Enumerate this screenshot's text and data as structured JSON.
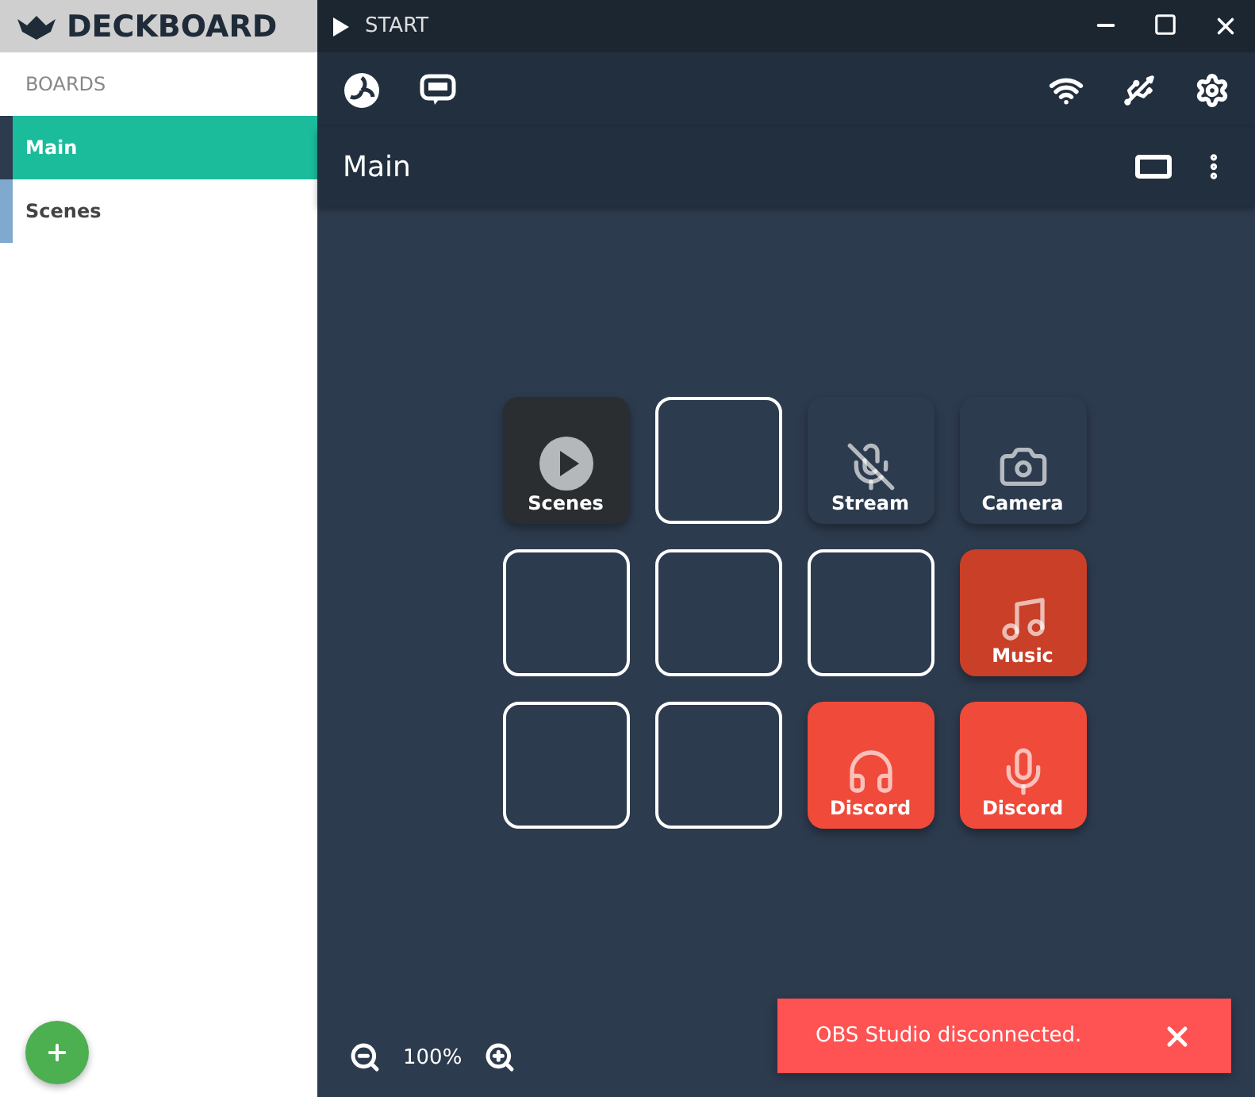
{
  "app": {
    "name": "DECKBOARD"
  },
  "sidebar": {
    "heading": "BOARDS",
    "items": [
      {
        "label": "Main",
        "selected": true
      },
      {
        "label": "Scenes",
        "selected": false
      }
    ]
  },
  "title_bar": {
    "action": "START"
  },
  "board": {
    "title": "Main",
    "zoom": "100%",
    "tiles": [
      {
        "kind": "play",
        "label": "Scenes",
        "color": "#2a2e30"
      },
      {
        "kind": "empty"
      },
      {
        "kind": "mute",
        "label": "Stream",
        "color": "#2d3b4e"
      },
      {
        "kind": "camera",
        "label": "Camera",
        "color": "#2d3b4e"
      },
      {
        "kind": "empty"
      },
      {
        "kind": "empty"
      },
      {
        "kind": "empty"
      },
      {
        "kind": "music",
        "label": "Music",
        "color": "#c93f27"
      },
      {
        "kind": "empty"
      },
      {
        "kind": "empty"
      },
      {
        "kind": "headphones",
        "label": "Discord",
        "color": "#ef4a3a"
      },
      {
        "kind": "mic",
        "label": "Discord",
        "color": "#ef4a3a"
      }
    ]
  },
  "toast": {
    "message": "OBS Studio disconnected."
  }
}
